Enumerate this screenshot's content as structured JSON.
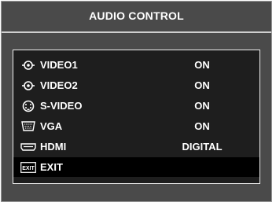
{
  "title": "AUDIO CONTROL",
  "menu": {
    "items": [
      {
        "label": "VIDEO1",
        "value": "ON",
        "icon": "rca-connector-icon"
      },
      {
        "label": "VIDEO2",
        "value": "ON",
        "icon": "rca-connector-icon"
      },
      {
        "label": "S-VIDEO",
        "value": "ON",
        "icon": "svideo-connector-icon"
      },
      {
        "label": "VGA",
        "value": "ON",
        "icon": "vga-connector-icon"
      },
      {
        "label": "HDMI",
        "value": "DIGITAL",
        "icon": "hdmi-connector-icon"
      }
    ],
    "exit_label": "EXIT",
    "exit_icon_text": "EXIT"
  },
  "colors": {
    "panel": "#4a4a4a",
    "menu_bg": "#1e1e1e",
    "selected_bg": "#000000",
    "text": "#ffffff"
  }
}
